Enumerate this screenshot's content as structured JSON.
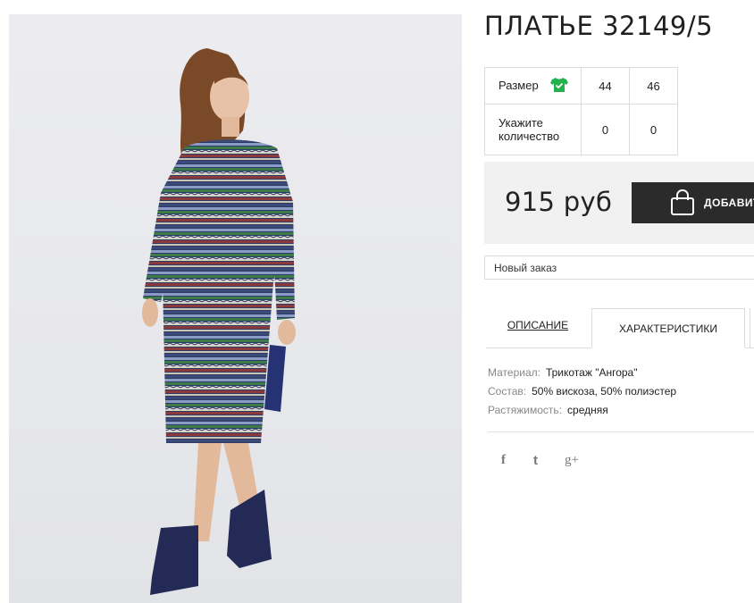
{
  "product": {
    "title": "ПЛАТЬЕ 32149/5",
    "size_label": "Размер",
    "sizes": [
      "44",
      "46"
    ],
    "quantity_label_1": "Укажите",
    "quantity_label_2": "количество",
    "quantities": [
      "0",
      "0"
    ],
    "price": "915 руб",
    "add_button_label": "ДОБАВИТ"
  },
  "order_select": {
    "value": "Новый заказ"
  },
  "tabs": [
    {
      "label": "ОПИСАНИЕ",
      "active": false
    },
    {
      "label": "ХАРАКТЕРИСТИКИ",
      "active": true
    }
  ],
  "specs": [
    {
      "key": "Материал:",
      "value": "Трикотаж \"Ангора\""
    },
    {
      "key": "Состав:",
      "value": "50% вискоза, 50% полиэстер"
    },
    {
      "key": "Растяжимость:",
      "value": "средняя"
    }
  ],
  "social": [
    {
      "icon": "facebook-icon",
      "glyph": "f"
    },
    {
      "icon": "twitter-icon",
      "glyph": "t"
    },
    {
      "icon": "google-plus-icon",
      "glyph": "g+"
    }
  ],
  "colors": {
    "size_icon": "#22b14c",
    "button_bg": "#2b2b2b",
    "price_bg": "#f1f1f1"
  }
}
